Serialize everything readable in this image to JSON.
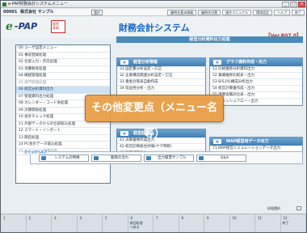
{
  "window": {
    "title": "e-PAP財務会計システムメニュー",
    "buttons": [
      "_",
      "□",
      "×"
    ]
  },
  "company": {
    "code": "00001",
    "name": "株式会社 サンプル",
    "selector": "選択"
  },
  "top_buttons": [
    "顧問先基本情報",
    "顧問先切替",
    "操作マニュアル",
    "環境設定",
    "ヘルプ",
    "終了"
  ],
  "header": {
    "logo_e": "e",
    "logo_pap": "-PAP",
    "seal": "経営\n革新",
    "app_title": "財務会計システム",
    "version": "【Ver.R07.0】"
  },
  "menu": {
    "items": [
      {
        "label": "00 ユーザ設定メニュー",
        "state": "normal"
      },
      {
        "label": "01 事前登録処理",
        "state": "normal"
      },
      {
        "label": "02 仕訳入力・月次処理",
        "state": "normal"
      },
      {
        "label": "03 消費税等処理",
        "state": "normal"
      },
      {
        "label": "04 繰越管理処理",
        "state": "normal"
      },
      {
        "label": "05 部門管理処理",
        "state": "dim"
      },
      {
        "label": "06 経営分析資料出力",
        "state": "active"
      },
      {
        "label": "07 管理資料出力処理",
        "state": "normal"
      },
      {
        "label": "08 カレンダー・コード表処理",
        "state": "normal"
      },
      {
        "label": "09 決算関係処理",
        "state": "normal"
      },
      {
        "label": "10 会計チェック処理",
        "state": "normal"
      },
      {
        "label": "11 外部データからの仕訳取込処理",
        "state": "normal"
      },
      {
        "label": "12 スマート・インポート",
        "state": "normal"
      },
      {
        "label": "13 期首処理",
        "state": "normal"
      },
      {
        "label": "14 PC会計データ取込処理",
        "state": "normal"
      },
      {
        "label": "15 クラウド・連携処理",
        "state": "dim"
      }
    ]
  },
  "main": {
    "heading": "経営分析資料出力処理",
    "panels": [
      {
        "id": "p1",
        "title": "経営分析情報",
        "rows": [
          "31 固定費分析設定・訂正",
          "32 企業構造関連分析設定・訂正",
          "33 資金対策表自動作成",
          "34 収益性分析・出力"
        ]
      },
      {
        "id": "p2",
        "title": "グラフ資料作成・出力",
        "rows": [
          "51 比較推移分析資料出力",
          "52 業績推移比較表・出力",
          "53 B/S,P/L構成分析出力",
          "54 経営計算書作成・出力",
          "55 予算実績対比表・出力",
          "56 キャッシュフロー・出力"
        ]
      },
      {
        "id": "p3",
        "title": "経営診断",
        "rows": [
          "41 決算書類作成出力",
          "42 経営診断総合評価(ヤマ判断)",
          "43 診断結果出力",
          "45 ローカルベンチマーク出力"
        ]
      },
      {
        "id": "p4",
        "title": "MAP経営用データ出力",
        "rows": [
          "71 MAP経営シミュレーションデータ出力"
        ]
      }
    ]
  },
  "overlay": {
    "text": "その他変更点（メニュー名等）"
  },
  "quick_help": {
    "label": "クイックヘルプ",
    "buttons": [
      "システムの特徴",
      "業務の流れ",
      "出力帳票サンプル",
      "Q&A"
    ]
  },
  "shortcut": {
    "label": "処理選択"
  },
  "function_keys": [
    {
      "num": "1",
      "label": ""
    },
    {
      "num": "2",
      "label": ""
    },
    {
      "num": "3",
      "label": ""
    },
    {
      "num": "4",
      "label": ""
    },
    {
      "num": "5",
      "label": ""
    },
    {
      "num": "6",
      "label": "前回処理\nへ戻る"
    },
    {
      "num": "7",
      "label": ""
    },
    {
      "num": "8",
      "label": ""
    },
    {
      "num": "9",
      "label": ""
    },
    {
      "num": "10",
      "label": ""
    },
    {
      "num": "11",
      "label": ""
    },
    {
      "num": "12",
      "label": "終了"
    }
  ]
}
